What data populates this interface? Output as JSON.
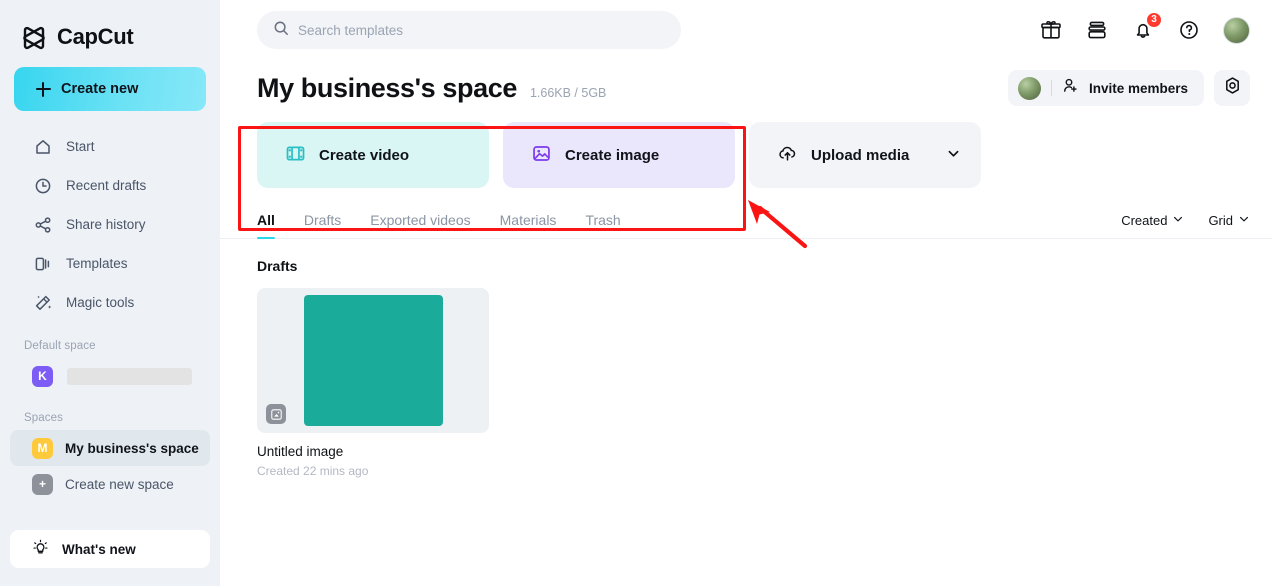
{
  "brand": {
    "name": "CapCut",
    "logo_icon": "capcut-logo-icon"
  },
  "sidebar": {
    "create_new": {
      "label": "Create new",
      "icon": "plus-icon"
    },
    "nav_items": [
      {
        "label": "Start",
        "icon": "home-icon"
      },
      {
        "label": "Recent drafts",
        "icon": "clock-icon"
      },
      {
        "label": "Share history",
        "icon": "share-icon"
      },
      {
        "label": "Templates",
        "icon": "templates-icon"
      },
      {
        "label": "Magic tools",
        "icon": "magic-wand-icon"
      }
    ],
    "default_space_label": "Default space",
    "default_space": {
      "initial": "K",
      "color": "#7c5cf5",
      "name_loading": true
    },
    "spaces_label": "Spaces",
    "spaces": [
      {
        "initial": "M",
        "color": "#ffc93c",
        "label": "My business's space",
        "active": true
      },
      {
        "initial": "+",
        "color": "#8c919a",
        "label": "Create new space",
        "active": false
      }
    ],
    "whats_new": {
      "label": "What's new",
      "icon": "lightbulb-icon"
    }
  },
  "topbar": {
    "search": {
      "placeholder": "Search templates",
      "icon": "search-icon"
    },
    "icons": [
      {
        "name": "gift-icon"
      },
      {
        "name": "archive-icon"
      },
      {
        "name": "bell-icon",
        "badge": "3",
        "badge_color": "#ff3b30"
      },
      {
        "name": "help-circle-icon"
      }
    ],
    "avatar": {
      "name": "user-avatar"
    }
  },
  "header": {
    "title": "My business's space",
    "storage": "1.66KB / 5GB",
    "invite": {
      "label": "Invite members",
      "icon": "person-add-icon"
    },
    "settings": {
      "icon": "gear-icon"
    }
  },
  "actions": [
    {
      "label": "Create video",
      "icon": "film-icon",
      "bg": "#d9f6f5",
      "icon_color": "#2bbfc4"
    },
    {
      "label": "Create image",
      "icon": "image-icon",
      "bg": "#eae6fc",
      "icon_color": "#7c3aed"
    },
    {
      "label": "Upload media",
      "icon": "cloud-upload-icon",
      "bg": "#f2f4f7",
      "chevron": "chevron-down-icon"
    }
  ],
  "tabs": [
    {
      "label": "All",
      "active": true
    },
    {
      "label": "Drafts",
      "active": false
    },
    {
      "label": "Exported videos",
      "active": false
    },
    {
      "label": "Materials",
      "active": false
    },
    {
      "label": "Trash",
      "active": false
    }
  ],
  "list_controls": [
    {
      "label": "Created",
      "icon": "chevron-down-icon"
    },
    {
      "label": "Grid",
      "icon": "chevron-down-icon"
    }
  ],
  "drafts": {
    "section_title": "Drafts",
    "items": [
      {
        "title": "Untitled image",
        "subtitle": "Created 22 mins ago",
        "thumb_color": "#1bab9b",
        "badge_icon": "image-badge-icon"
      }
    ]
  },
  "annotations": {
    "highlight_color": "#fb1414",
    "arrow_color": "#fb1414"
  }
}
